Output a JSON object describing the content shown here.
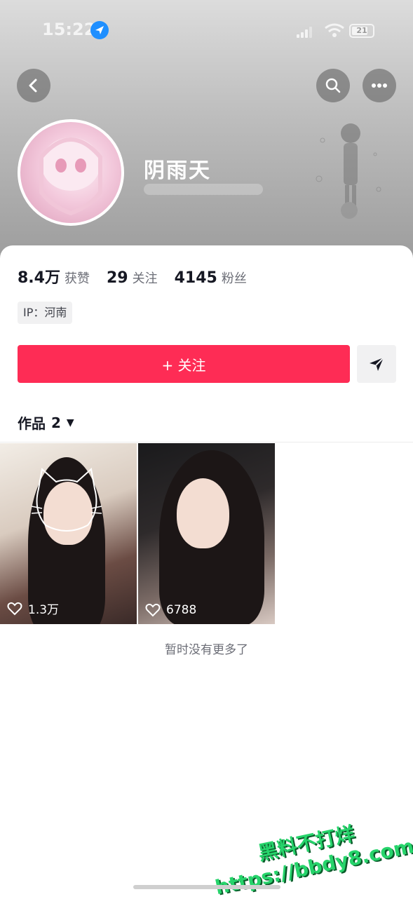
{
  "status_bar": {
    "time": "15:22",
    "battery": "21"
  },
  "profile": {
    "nickname": "阴雨天"
  },
  "stats": {
    "likes_value": "8.4万",
    "likes_label": "获赞",
    "following_value": "29",
    "following_label": "关注",
    "followers_value": "4145",
    "followers_label": "粉丝"
  },
  "ip_location": "IP：河南",
  "actions": {
    "follow_label": "+ 关注"
  },
  "works_tab": {
    "label": "作品",
    "count": "2"
  },
  "videos": [
    {
      "likes": "1.3万"
    },
    {
      "likes": "6788"
    }
  ],
  "footer_note": "暂时没有更多了",
  "watermark": {
    "line1": "黑料不打烊",
    "line2": "https://bbdy8.com"
  },
  "colors": {
    "accent": "#fe2c55",
    "location_icon": "#1f8fff"
  },
  "icons": [
    "back-icon",
    "search-icon",
    "more-icon",
    "send-icon",
    "heart-icon",
    "location-icon"
  ]
}
